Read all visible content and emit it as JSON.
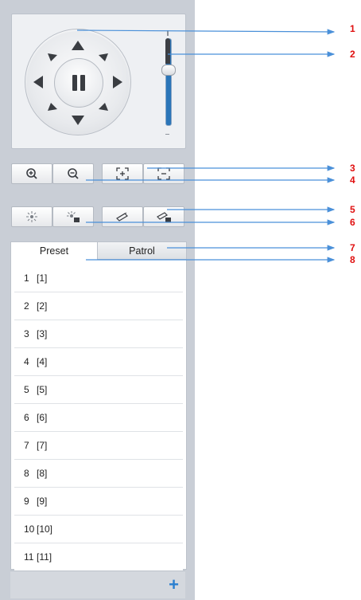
{
  "ptz": {
    "direction_icons": [
      "up-arrow-icon",
      "up-right-arrow-icon",
      "right-arrow-icon",
      "down-right-arrow-icon",
      "down-arrow-icon",
      "down-left-arrow-icon",
      "left-arrow-icon",
      "up-left-arrow-icon"
    ],
    "center_icon": "pause-icon"
  },
  "toolbar1": {
    "icons": [
      "zoom-in-icon",
      "zoom-out-icon",
      "focus-near-icon",
      "focus-far-icon"
    ]
  },
  "toolbar2": {
    "icons": [
      "light-icon",
      "light-settings-icon",
      "wiper-icon",
      "wiper-settings-icon"
    ]
  },
  "tabs": {
    "preset_label": "Preset",
    "patrol_label": "Patrol"
  },
  "presets": [
    {
      "num": "1",
      "name": "[1]"
    },
    {
      "num": "2",
      "name": "[2]"
    },
    {
      "num": "3",
      "name": "[3]"
    },
    {
      "num": "4",
      "name": "[4]"
    },
    {
      "num": "5",
      "name": "[5]"
    },
    {
      "num": "6",
      "name": "[6]"
    },
    {
      "num": "7",
      "name": "[7]"
    },
    {
      "num": "8",
      "name": "[8]"
    },
    {
      "num": "9",
      "name": "[9]"
    },
    {
      "num": "10",
      "name": "[10]"
    },
    {
      "num": "11",
      "name": "[11]"
    }
  ],
  "add_button_label": "+",
  "callouts": [
    "1",
    "2",
    "3",
    "4",
    "5",
    "6",
    "7",
    "8"
  ],
  "colors": {
    "callout_line": "#4a90d9",
    "callout_text": "#e01010",
    "slider": "#2b75b8",
    "add": "#2a7fd0"
  }
}
